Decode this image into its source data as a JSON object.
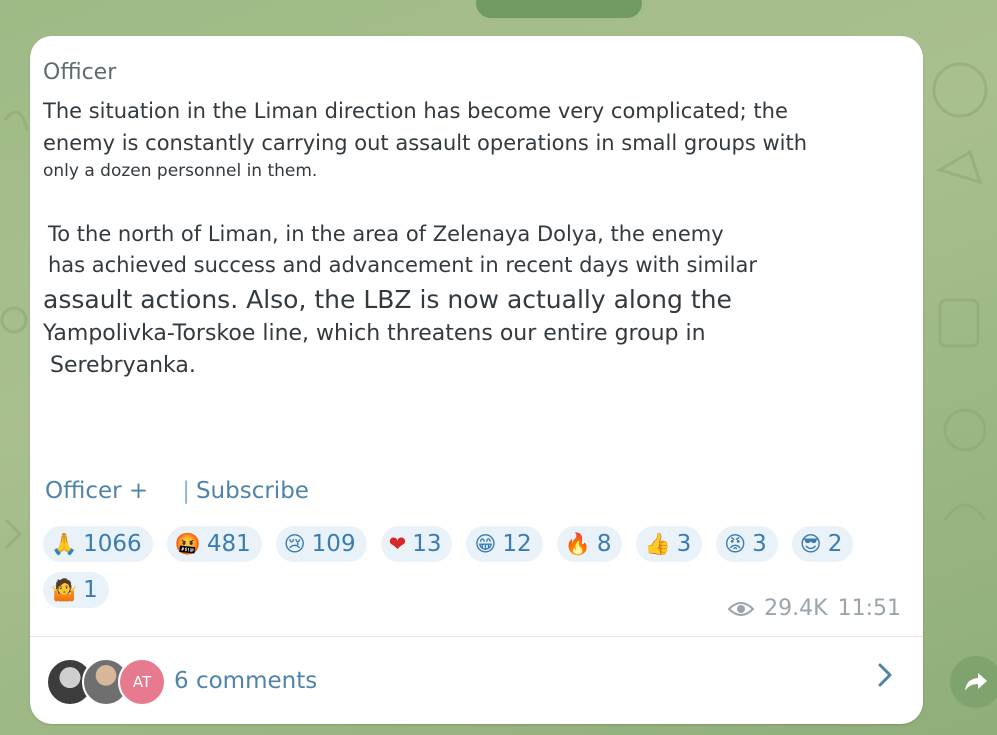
{
  "post": {
    "sender": "Officer",
    "para1_line1": "The situation in the Liman direction has become very complicated; the",
    "para1_line2": "enemy is constantly carrying out assault operations in small groups with",
    "para1_line3": "only a dozen personnel in them.",
    "para2_line1": "To the north of Liman, in the area of Zelenaya Dolya, the enemy",
    "para2_line2": "has achieved success and advancement in recent days with similar",
    "para2_line3": "assault actions. Also, the LBZ is now actually along the",
    "para2_line4": "Yampolivka-Torskoe line, which threatens our entire group in",
    "para2_line5": "Serebryanka."
  },
  "footer": {
    "channel_link": "Officer +",
    "separator": "|",
    "subscribe_link": "Subscribe"
  },
  "reactions": [
    {
      "emoji": "🙏",
      "count": "1066",
      "icon": "folded-hands-icon"
    },
    {
      "emoji": "🤬",
      "count": "481",
      "icon": "cursing-face-icon"
    },
    {
      "emoji": "😢",
      "count": "109",
      "icon": "crying-face-icon"
    },
    {
      "emoji": "❤",
      "count": "13",
      "icon": "red-heart-icon"
    },
    {
      "emoji": "😁",
      "count": "12",
      "icon": "grinning-face-icon"
    },
    {
      "emoji": "🔥",
      "count": "8",
      "icon": "fire-icon"
    },
    {
      "emoji": "👍",
      "count": "3",
      "icon": "thumbs-up-icon"
    },
    {
      "emoji": "😡",
      "count": "3",
      "icon": "angry-face-icon"
    },
    {
      "emoji": "😎",
      "count": "2",
      "icon": "sunglasses-face-icon"
    },
    {
      "emoji": "🤷",
      "count": "1",
      "icon": "shrug-icon"
    }
  ],
  "meta": {
    "views": "29.4K",
    "time": "11:51"
  },
  "comments": {
    "label": "6 comments",
    "avatar3_initials": "AT"
  },
  "colors": {
    "link": "#4f84a9",
    "reaction_bg": "#e9f2f8",
    "wallpaper": "#a9c08e"
  }
}
